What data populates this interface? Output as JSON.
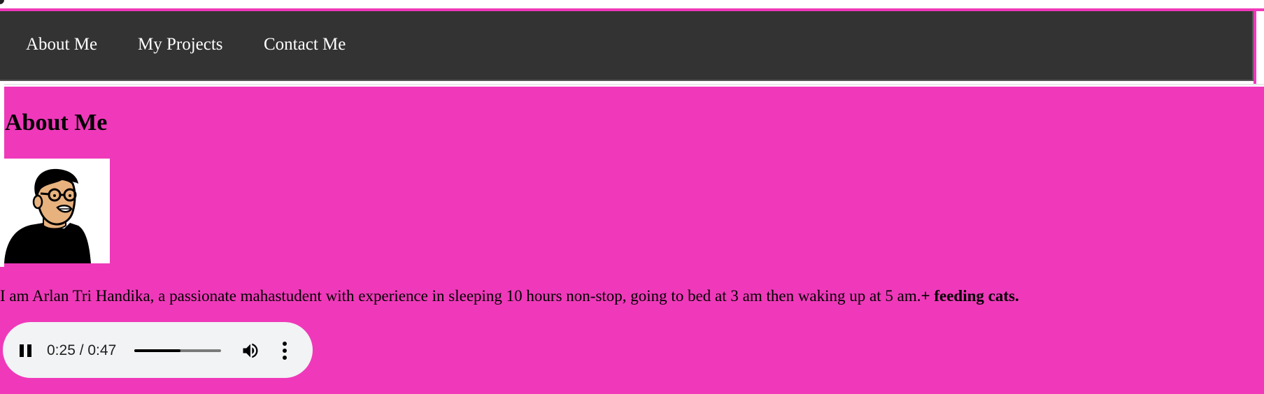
{
  "nav": {
    "items": [
      {
        "label": "About Me"
      },
      {
        "label": "My Projects"
      },
      {
        "label": "Contact Me"
      }
    ]
  },
  "about": {
    "title": "About Me",
    "bio_text": "I am Arlan Tri Handika, a passionate mahastudent with experience in sleeping 10 hours non-stop, going to bed at 3 am then waking up at 5 am.",
    "bio_bold": "+ feeding cats."
  },
  "audio": {
    "state": "playing",
    "time_display": "0:25 / 0:47",
    "progress": 0.53,
    "icons": [
      "pause-icon",
      "volume-icon",
      "more-vert-icon"
    ]
  },
  "colors": {
    "navbar_bg": "#333333",
    "content_bg": "#ef39ba",
    "player_bg": "#f1f3f4"
  }
}
